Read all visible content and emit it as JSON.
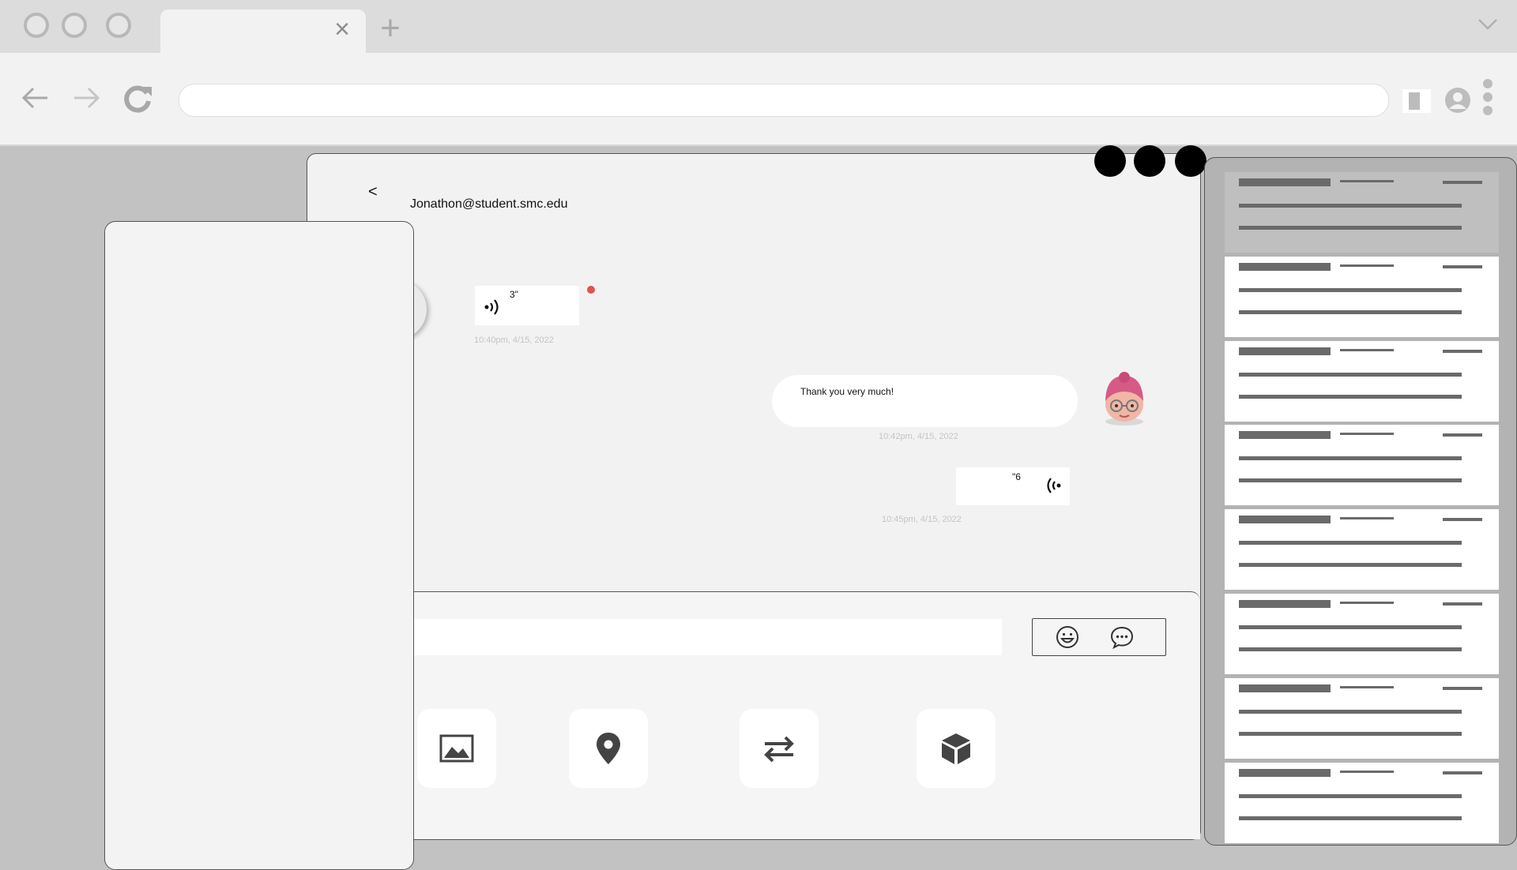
{
  "browser": {
    "tab_close_glyph": "×",
    "new_tab_glyph": "+"
  },
  "chat": {
    "back_label": "<",
    "contact": "Jonathon@student.smc.edu",
    "messages": [
      {
        "type": "voice",
        "direction": "incoming",
        "duration": "3\"",
        "timestamp": "10:40pm, 4/15, 2022",
        "unread": true
      },
      {
        "type": "text",
        "direction": "outgoing",
        "text": "Thank you very much!",
        "timestamp": "10:42pm, 4/15, 2022"
      },
      {
        "type": "voice",
        "direction": "outgoing",
        "duration": "\"6",
        "timestamp": "10:45pm, 4/15, 2022"
      }
    ],
    "input": {
      "value": "",
      "placeholder": ""
    },
    "actions": [
      "image-icon",
      "location-pin-icon",
      "transfer-icon",
      "package-icon"
    ]
  },
  "right_list": {
    "item_count": 8,
    "selected_index": 0
  },
  "colors": {
    "page_background": "#c2c2c2",
    "unread_dot": "#e35050",
    "avatar_hair": "#d65a86",
    "list_bar": "#6a6a6a"
  }
}
